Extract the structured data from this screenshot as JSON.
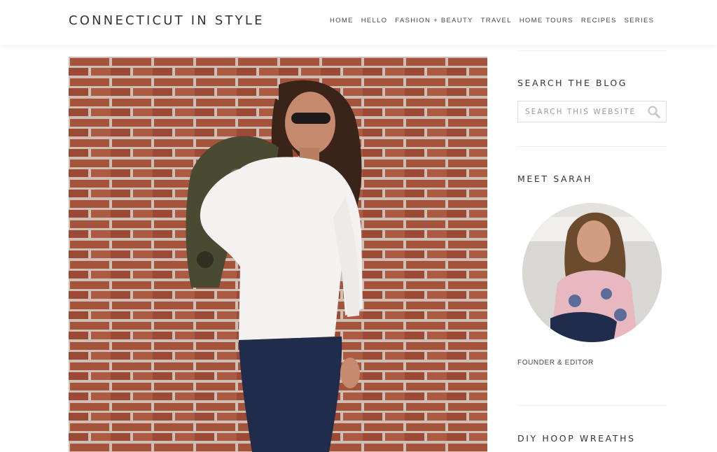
{
  "header": {
    "site_title": "CONNECTICUT IN STYLE",
    "nav": [
      "HOME",
      "HELLO",
      "FASHION + BEAUTY",
      "TRAVEL",
      "HOME TOURS",
      "RECIPES",
      "SERIES"
    ]
  },
  "sidebar": {
    "search_title": "SEARCH THE BLOG",
    "search_placeholder": "SEARCH THIS WEBSITE",
    "meet_title": "MEET SARAH",
    "founder_caption": "FOUNDER & EDITOR",
    "next_title": "DIY HOOP WREATHS"
  },
  "colors": {
    "brick": "#a6533c",
    "mortar": "#cdbfb4",
    "text": "#333333"
  }
}
